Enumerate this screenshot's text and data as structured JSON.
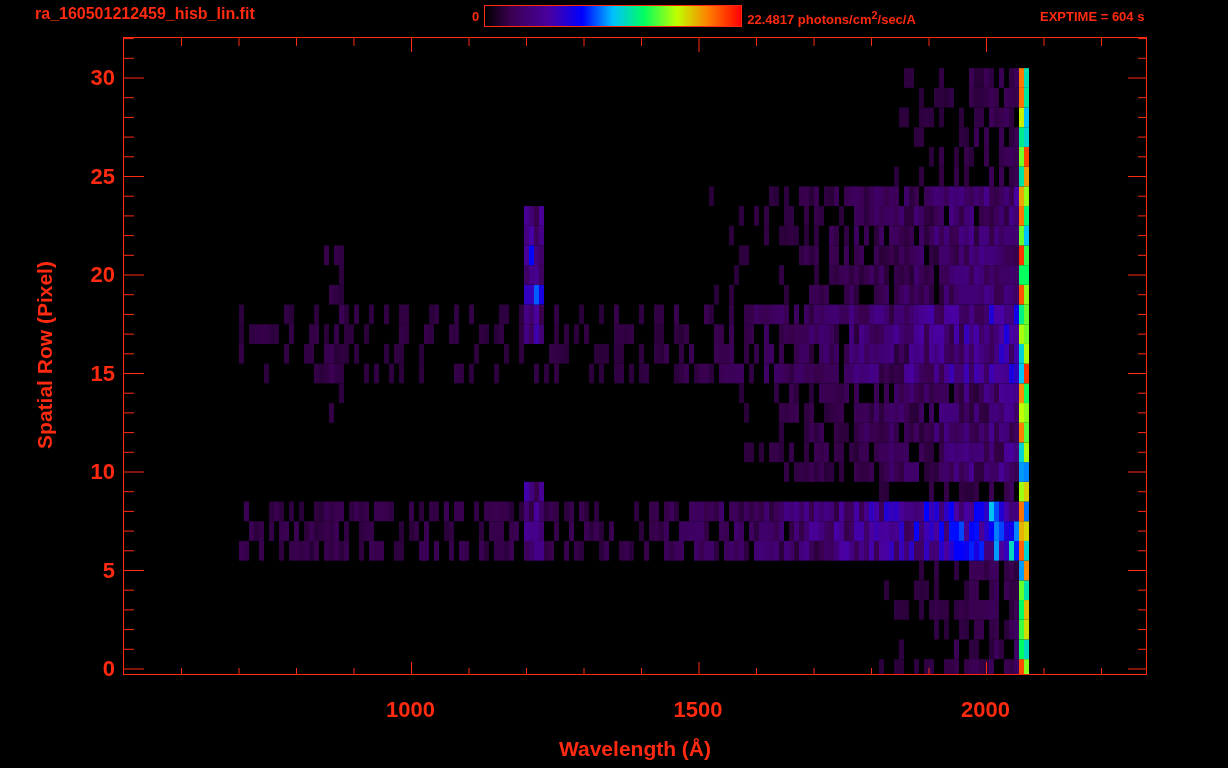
{
  "header": {
    "filename": "ra_160501212459_hisb_lin.fit",
    "colorbar": {
      "min_label": "0",
      "max_label": "22.4817 photons/cm$^{2}$/sec/A"
    },
    "exposure": "EXPTIME = 604 s"
  },
  "plot": {
    "ylabel": "Spatial Row (Pixel)",
    "yticks": [
      "30",
      "25",
      "20",
      "15",
      "10",
      "5",
      "0"
    ],
    "xlabel": "Wavelength (Å)",
    "xticks": [
      "1000",
      "1500",
      "2000"
    ]
  }
}
